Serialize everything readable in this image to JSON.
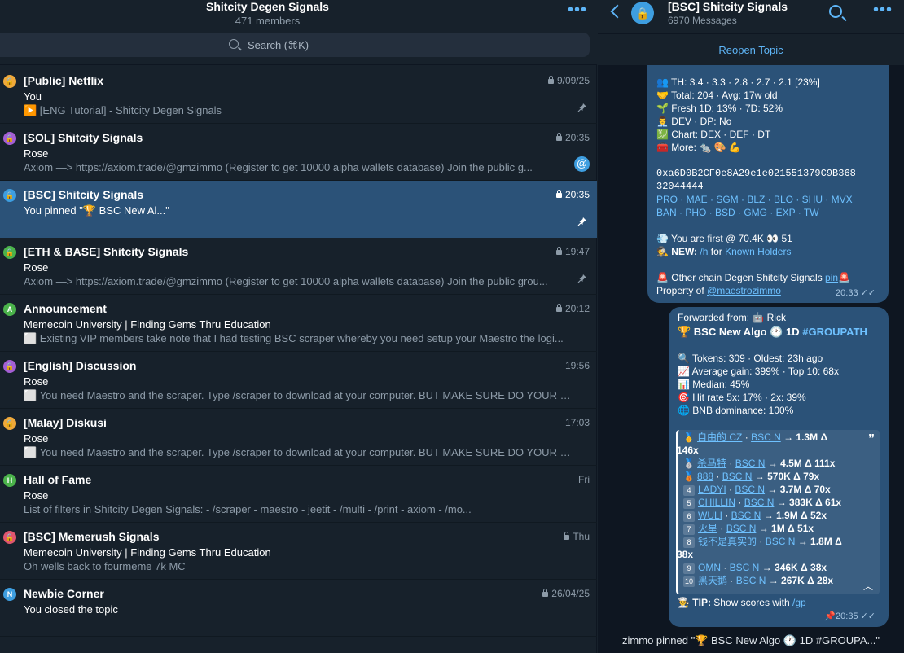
{
  "left_header": {
    "title": "Shitcity Degen Signals",
    "members": "471 members",
    "more": "•••",
    "search_placeholder": "Search (⌘K)"
  },
  "chats": [
    {
      "avatar_letter": "🔒",
      "avatar_color": "#f0a93a",
      "title": "[Public] Netflix",
      "time": "9/09/25",
      "locked": true,
      "sender": "You",
      "preview": "▶️ [ENG Tutorial] - Shitcity Degen Signals",
      "pinned": true,
      "mention": false,
      "active": false
    },
    {
      "avatar_letter": "🔒",
      "avatar_color": "#a45fd4",
      "title": "[SOL] Shitcity Signals",
      "time": "20:35",
      "locked": true,
      "sender": "Rose",
      "preview": "Axiom —> https://axiom.trade/@gmzimmo (Register to get 10000 alpha wallets database) Join the public g...",
      "pinned": false,
      "mention": true,
      "active": false
    },
    {
      "avatar_letter": "🔒",
      "avatar_color": "#3e9ee0",
      "title": "[BSC] Shitcity Signals",
      "time": "20:35",
      "locked": true,
      "sender": "You pinned \"🏆 BSC New Al...\"",
      "preview": "",
      "pinned": true,
      "mention": false,
      "active": true
    },
    {
      "avatar_letter": "🔒",
      "avatar_color": "#4bb34b",
      "title": "[ETH & BASE] Shitcity Signals",
      "time": "19:47",
      "locked": true,
      "sender": "Rose",
      "preview": "Axiom —> https://axiom.trade/@gmzimmo (Register to get 10000 alpha wallets database) Join the public grou...",
      "pinned": true,
      "mention": false,
      "active": false
    },
    {
      "avatar_letter": "A",
      "avatar_color": "#4bb34b",
      "title": "Announcement",
      "time": "20:12",
      "locked": true,
      "sender": "Memecoin University | Finding Gems Thru Education",
      "preview": "⬜ Existing VIP members take note that I had testing BSC scraper whereby you need setup your Maestro the logi...",
      "pinned": false,
      "mention": false,
      "active": false
    },
    {
      "avatar_letter": "🔒",
      "avatar_color": "#a45fd4",
      "title": "[English] Discussion",
      "time": "19:56",
      "locked": false,
      "sender": "Rose",
      "preview": "⬜ You need Maestro and the scraper. Type /scraper to download at your computer. BUT MAKE SURE DO YOUR S...",
      "pinned": false,
      "mention": false,
      "active": false
    },
    {
      "avatar_letter": "🔒",
      "avatar_color": "#f0a93a",
      "title": "[Malay] Diskusi",
      "time": "17:03",
      "locked": false,
      "sender": "Rose",
      "preview": "⬜ You need Maestro and the scraper. Type /scraper to download at your computer. BUT MAKE SURE DO YOUR S...",
      "pinned": false,
      "mention": false,
      "active": false
    },
    {
      "avatar_letter": "H",
      "avatar_color": "#4bb34b",
      "title": "Hall of Fame",
      "time": "Fri",
      "locked": false,
      "sender": "Rose",
      "preview": "List of filters in Shitcity Degen Signals: - /scraper - maestro - jeetit - /multi - /print - axiom - /mo...",
      "pinned": false,
      "mention": false,
      "active": false
    },
    {
      "avatar_letter": "🔒",
      "avatar_color": "#e0566e",
      "title": "[BSC] Memerush Signals",
      "time": "Thu",
      "locked": true,
      "sender": "Memecoin University | Finding Gems Thru Education",
      "preview": "Oh wells back to fourmeme 7k MC",
      "pinned": false,
      "mention": false,
      "active": false
    },
    {
      "avatar_letter": "N",
      "avatar_color": "#3e9ee0",
      "title": "Newbie Corner",
      "time": "26/04/25",
      "locked": true,
      "sender": "You closed the topic",
      "preview": "",
      "pinned": false,
      "mention": false,
      "active": false
    }
  ],
  "right_header": {
    "title": "[BSC] Shitcity Signals",
    "subtitle": "6970 Messages",
    "reopen": "Reopen Topic"
  },
  "message1": {
    "lines": [
      "👥 TH: 3.4 · 3.3 · 2.8 · 2.7 · 2.1 [23%]",
      "🤝 Total: 204 · Avg: 17w old",
      "🌱 Fresh 1D: 13% · 7D: 52%",
      "👨‍💼 DEV · DP: No",
      "💹 Chart: DEX · DEF · DT",
      "🧰 More: 🐀 🎨 💪"
    ],
    "address_1": "0xa6D0B2CF0e8A29e1e021551379C9B368",
    "address_2": "32044444",
    "links_1": "PRO · MAE · SGM · BLZ · BLO · SHU · MVX",
    "links_2": "BAN · PHO · BSD · GMG · EXP · TW",
    "first": "💨 You are first @ 70.4K 👀 51",
    "new_prefix": "🕵 NEW: ",
    "new_link": "/h",
    "new_mid": " for ",
    "new_link2": "Known Holders",
    "other_prefix": "🚨 Other chain Degen Shitcity Signals ",
    "other_link": "pin",
    "other_suffix": "🚨",
    "property_prefix": "Property of ",
    "property_link": "@maestrozimmo",
    "time": "20:33"
  },
  "message2": {
    "forwarded": "Forwarded from: 🤖 Rick",
    "title_prefix": "🏆 BSC New Algo 🕐 1D ",
    "title_tag": "#GROUPATH",
    "stats": [
      "🔍 Tokens: 309 · Oldest: 23h ago",
      "📈 Average gain: 399% · Top 10: 68x",
      "📊 Median: 45%",
      "🎯 Hit rate 5x: 17% · 2x: 39%",
      "🌐 BNB dominance: 100%"
    ],
    "quote_rows": [
      {
        "rank": "🥇",
        "name": "自由的 CZ",
        "chain": "BSC N",
        "value": "→ 1.3M Δ",
        "mult": "146x",
        "wrap": true
      },
      {
        "rank": "🥈",
        "name": "杀马特",
        "chain": "BSC N",
        "value": "→ 4.5M Δ 111x",
        "mult": "",
        "wrap": false
      },
      {
        "rank": "🥉",
        "name": "888",
        "chain": "BSC N",
        "value": "→ 570K Δ 79x",
        "mult": "",
        "wrap": false
      },
      {
        "rank": "4",
        "name": "LADYI",
        "chain": "BSC N",
        "value": "→ 3.7M Δ 70x",
        "mult": "",
        "wrap": false
      },
      {
        "rank": "5",
        "name": "CHILLIN",
        "chain": "BSC N",
        "value": "→ 383K Δ 61x",
        "mult": "",
        "wrap": false
      },
      {
        "rank": "6",
        "name": "WULI",
        "chain": "BSC N",
        "value": "→ 1.9M Δ 52x",
        "mult": "",
        "wrap": false
      },
      {
        "rank": "7",
        "name": "火星",
        "chain": "BSC N",
        "value": "→ 1M Δ 51x",
        "mult": "",
        "wrap": false
      },
      {
        "rank": "8",
        "name": "钱不是真实的",
        "chain": "BSC N",
        "value": "→ 1.8M Δ",
        "mult": "38x",
        "wrap": true
      },
      {
        "rank": "9",
        "name": "OMN",
        "chain": "BSC N",
        "value": "→ 346K Δ 38x",
        "mult": "",
        "wrap": false
      },
      {
        "rank": "10",
        "name": "黑天鹅",
        "chain": "BSC N",
        "value": "→ 267K Δ 28x",
        "mult": "",
        "wrap": false
      }
    ],
    "tip_prefix": "👨‍🍳 TIP: ",
    "tip_text": "Show scores with ",
    "tip_link": "/gp",
    "time": "20:35"
  },
  "service_message": "zimmo pinned \"🏆 BSC New Algo 🕐 1D #GROUPA...\""
}
